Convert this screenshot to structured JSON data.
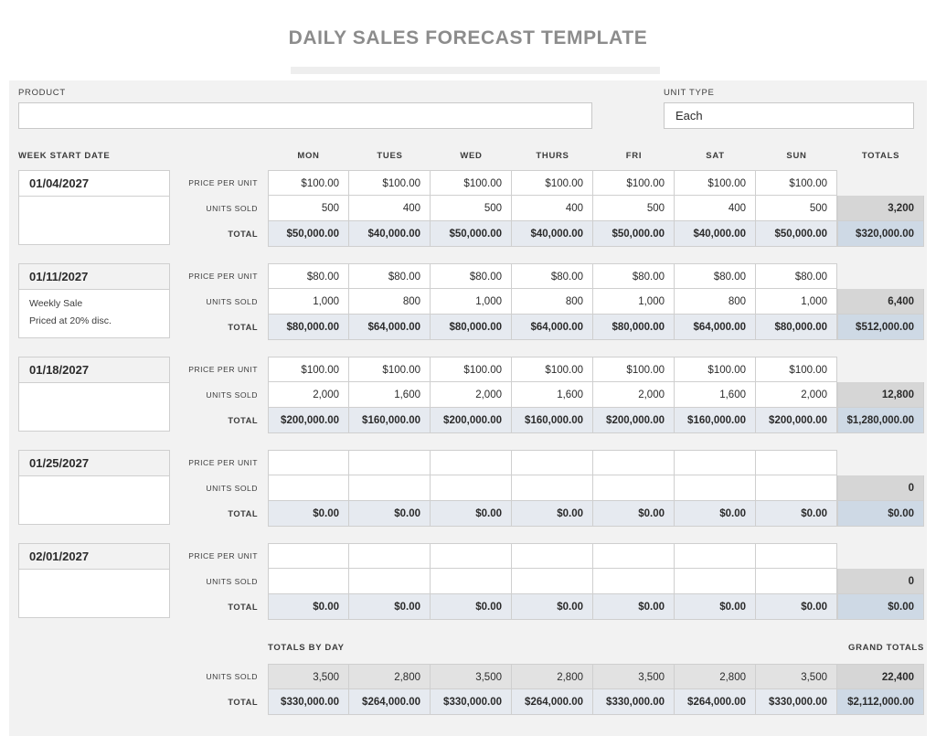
{
  "document": {
    "title": "DAILY SALES FORECAST TEMPLATE"
  },
  "fields": {
    "product_label": "PRODUCT",
    "product_value": "",
    "unit_type_label": "UNIT TYPE",
    "unit_type_value": "Each"
  },
  "table": {
    "week_start_label": "WEEK START DATE",
    "day_headers": [
      "MON",
      "TUES",
      "WED",
      "THURS",
      "FRI",
      "SAT",
      "SUN"
    ],
    "totals_header": "TOTALS",
    "row_labels": {
      "price": "PRICE PER UNIT",
      "units": "UNITS SOLD",
      "total": "TOTAL"
    },
    "weeks": [
      {
        "date": "01/04/2027",
        "notes": [
          "",
          ""
        ],
        "date_shaded": false,
        "price": [
          "$100.00",
          "$100.00",
          "$100.00",
          "$100.00",
          "$100.00",
          "$100.00",
          "$100.00"
        ],
        "units": [
          "500",
          "400",
          "500",
          "400",
          "500",
          "400",
          "500"
        ],
        "total": [
          "$50,000.00",
          "$40,000.00",
          "$50,000.00",
          "$40,000.00",
          "$50,000.00",
          "$40,000.00",
          "$50,000.00"
        ],
        "units_total": "3,200",
        "money_total": "$320,000.00"
      },
      {
        "date": "01/11/2027",
        "notes": [
          "Weekly Sale",
          "Priced at 20% disc."
        ],
        "date_shaded": true,
        "price": [
          "$80.00",
          "$80.00",
          "$80.00",
          "$80.00",
          "$80.00",
          "$80.00",
          "$80.00"
        ],
        "units": [
          "1,000",
          "800",
          "1,000",
          "800",
          "1,000",
          "800",
          "1,000"
        ],
        "total": [
          "$80,000.00",
          "$64,000.00",
          "$80,000.00",
          "$64,000.00",
          "$80,000.00",
          "$64,000.00",
          "$80,000.00"
        ],
        "units_total": "6,400",
        "money_total": "$512,000.00"
      },
      {
        "date": "01/18/2027",
        "notes": [
          "",
          ""
        ],
        "date_shaded": true,
        "price": [
          "$100.00",
          "$100.00",
          "$100.00",
          "$100.00",
          "$100.00",
          "$100.00",
          "$100.00"
        ],
        "units": [
          "2,000",
          "1,600",
          "2,000",
          "1,600",
          "2,000",
          "1,600",
          "2,000"
        ],
        "total": [
          "$200,000.00",
          "$160,000.00",
          "$200,000.00",
          "$160,000.00",
          "$200,000.00",
          "$160,000.00",
          "$200,000.00"
        ],
        "units_total": "12,800",
        "money_total": "$1,280,000.00"
      },
      {
        "date": "01/25/2027",
        "notes": [
          "",
          ""
        ],
        "date_shaded": true,
        "price": [
          "",
          "",
          "",
          "",
          "",
          "",
          ""
        ],
        "units": [
          "",
          "",
          "",
          "",
          "",
          "",
          ""
        ],
        "total": [
          "$0.00",
          "$0.00",
          "$0.00",
          "$0.00",
          "$0.00",
          "$0.00",
          "$0.00"
        ],
        "units_total": "0",
        "money_total": "$0.00"
      },
      {
        "date": "02/01/2027",
        "notes": [
          "",
          ""
        ],
        "date_shaded": true,
        "price": [
          "",
          "",
          "",
          "",
          "",
          "",
          ""
        ],
        "units": [
          "",
          "",
          "",
          "",
          "",
          "",
          ""
        ],
        "total": [
          "$0.00",
          "$0.00",
          "$0.00",
          "$0.00",
          "$0.00",
          "$0.00",
          "$0.00"
        ],
        "units_total": "0",
        "money_total": "$0.00"
      }
    ],
    "footer": {
      "totals_by_day_label": "TOTALS BY DAY",
      "grand_totals_label": "GRAND TOTALS",
      "units_label": "UNITS SOLD",
      "total_label": "TOTAL",
      "units": [
        "3,500",
        "2,800",
        "3,500",
        "2,800",
        "3,500",
        "2,800",
        "3,500"
      ],
      "units_grand": "22,400",
      "total": [
        "$330,000.00",
        "$264,000.00",
        "$330,000.00",
        "$264,000.00",
        "$330,000.00",
        "$264,000.00",
        "$330,000.00"
      ],
      "total_grand": "$2,112,000.00"
    }
  },
  "colors": {
    "panel_bg": "#f2f2f2",
    "title": "#8c8c8c",
    "total_row_bg": "#e6eaf0",
    "units_total_bg": "#d6d6d6",
    "money_total_bg": "#ced9e5",
    "grid_border": "#cfcfcf"
  }
}
